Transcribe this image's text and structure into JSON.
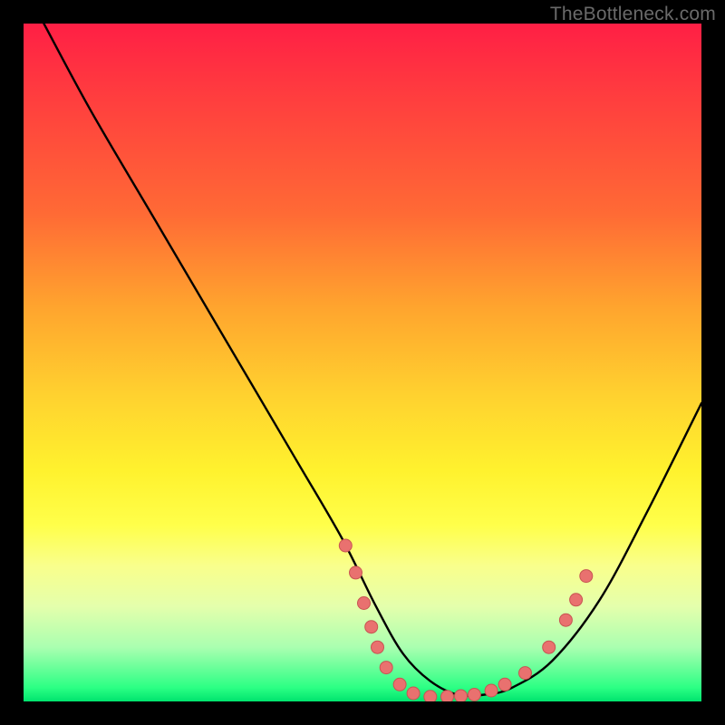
{
  "watermark": "TheBottleneck.com",
  "colors": {
    "background": "#000000",
    "gradient_top": "#ff1f45",
    "gradient_mid": "#fff22e",
    "gradient_bottom": "#00e46e",
    "curve": "#000000",
    "marker_fill": "#e9716f",
    "marker_stroke": "#c85452"
  },
  "chart_data": {
    "type": "line",
    "title": "",
    "xlabel": "",
    "ylabel": "",
    "xlim": [
      0,
      100
    ],
    "ylim": [
      0,
      100
    ],
    "grid": false,
    "legend": false,
    "series": [
      {
        "name": "bottleneck-curve",
        "x": [
          3,
          10,
          20,
          30,
          40,
          47,
          52,
          56,
          60,
          64,
          68,
          72,
          78,
          85,
          92,
          100
        ],
        "y": [
          100,
          87,
          70,
          53,
          36,
          24,
          14,
          7,
          3,
          1,
          1,
          2,
          6,
          15,
          28,
          44
        ]
      }
    ],
    "markers": [
      {
        "x": 47.5,
        "y": 23.0
      },
      {
        "x": 49.0,
        "y": 19.0
      },
      {
        "x": 50.2,
        "y": 14.5
      },
      {
        "x": 51.3,
        "y": 11.0
      },
      {
        "x": 52.2,
        "y": 8.0
      },
      {
        "x": 53.5,
        "y": 5.0
      },
      {
        "x": 55.5,
        "y": 2.5
      },
      {
        "x": 57.5,
        "y": 1.2
      },
      {
        "x": 60.0,
        "y": 0.7
      },
      {
        "x": 62.5,
        "y": 0.7
      },
      {
        "x": 64.5,
        "y": 0.8
      },
      {
        "x": 66.5,
        "y": 1.0
      },
      {
        "x": 69.0,
        "y": 1.6
      },
      {
        "x": 71.0,
        "y": 2.5
      },
      {
        "x": 74.0,
        "y": 4.2
      },
      {
        "x": 77.5,
        "y": 8.0
      },
      {
        "x": 80.0,
        "y": 12.0
      },
      {
        "x": 81.5,
        "y": 15.0
      },
      {
        "x": 83.0,
        "y": 18.5
      }
    ]
  }
}
